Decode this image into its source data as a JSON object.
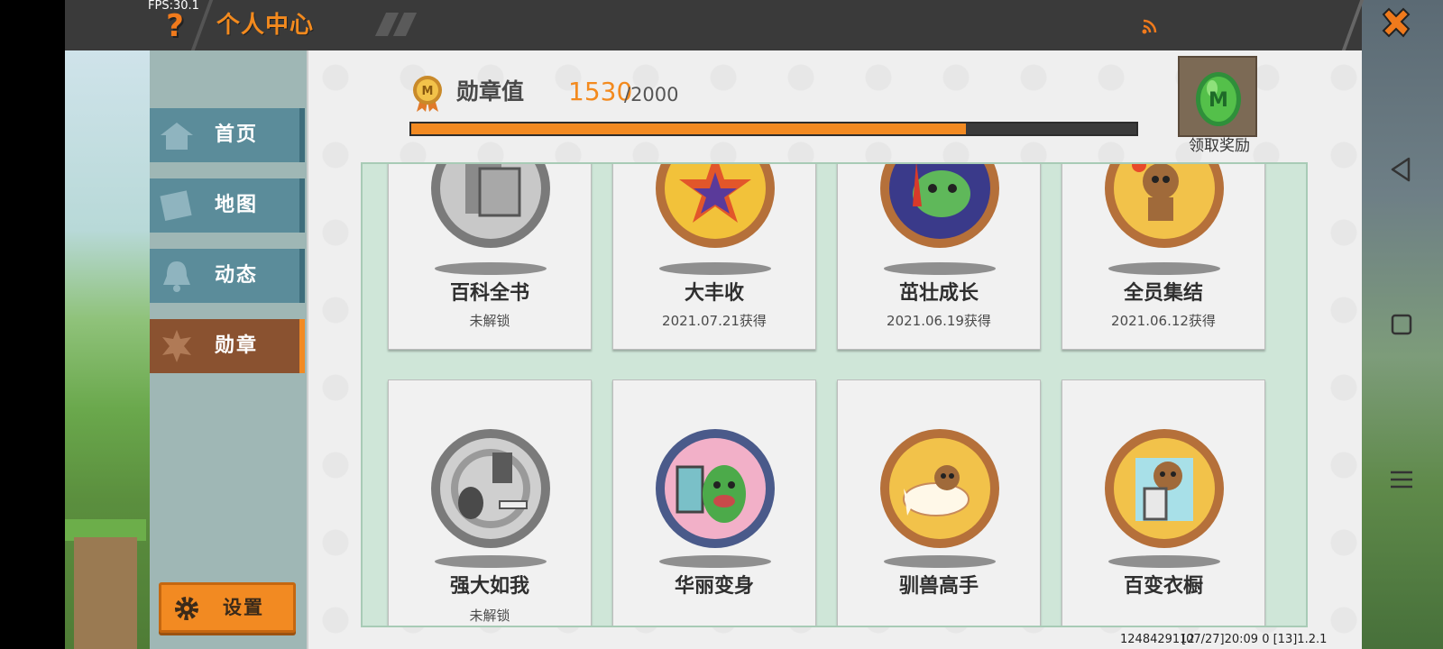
{
  "header": {
    "fps": "FPS:30.1",
    "help_icon": "question-mark-icon",
    "title": "个人中心",
    "close_icon": "close-x-icon"
  },
  "sidebar": {
    "items": [
      {
        "label": "首页",
        "icon": "home-icon",
        "active": false
      },
      {
        "label": "地图",
        "icon": "map-icon",
        "active": false
      },
      {
        "label": "动态",
        "icon": "bell-icon",
        "active": false
      },
      {
        "label": "勋章",
        "icon": "medal-icon",
        "active": true
      }
    ],
    "settings_label": "设置"
  },
  "medal": {
    "label": "勋章值",
    "current": "1530",
    "total": "/2000",
    "progress": 0.765,
    "reward_label": "领取奖励"
  },
  "badges": [
    {
      "name": "百科全书",
      "status": "未解锁",
      "locked": true
    },
    {
      "name": "大丰收",
      "status": "2021.07.21获得",
      "locked": false
    },
    {
      "name": "茁壮成长",
      "status": "2021.06.19获得",
      "locked": false
    },
    {
      "name": "全员集结",
      "status": "2021.06.12获得",
      "locked": false
    },
    {
      "name": "强大如我",
      "status": "未解锁",
      "locked": true
    },
    {
      "name": "华丽变身",
      "status": "",
      "locked": false
    },
    {
      "name": "驯兽高手",
      "status": "",
      "locked": false
    },
    {
      "name": "百变衣橱",
      "status": "",
      "locked": false
    }
  ],
  "footer": {
    "uid": "1248429112",
    "info": "[07/27]20:09 0  [13]1.2.1"
  },
  "colors": {
    "accent": "#f28a22",
    "header_bg": "#3a3a3a",
    "sidebar_item": "#5b8c9a",
    "active_item": "#8a5230",
    "grid_bg": "#cfe6d8"
  }
}
